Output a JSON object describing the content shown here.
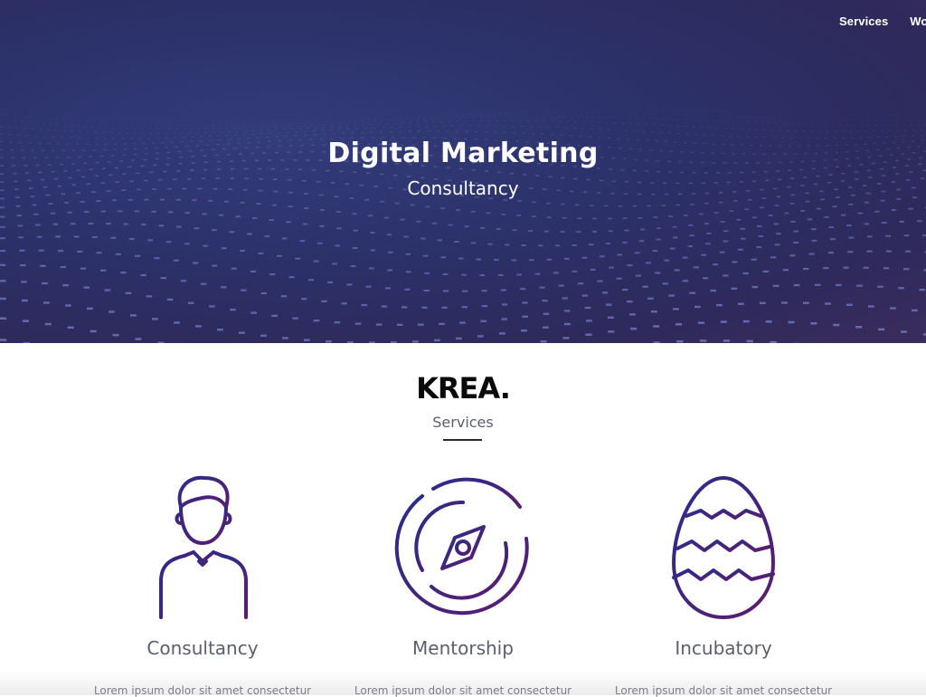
{
  "nav": {
    "items": [
      {
        "label": "Services"
      },
      {
        "label": "Work"
      }
    ]
  },
  "hero": {
    "title": "Digital Marketing",
    "subtitle": "Consultancy"
  },
  "brand": {
    "logo": "KREA."
  },
  "services_section": {
    "title": "Services",
    "items": [
      {
        "name": "Consultancy",
        "icon": "businessman-icon",
        "text": "Lorem ipsum dolor sit amet consectetur"
      },
      {
        "name": "Mentorship",
        "icon": "compass-icon",
        "text": "Lorem ipsum dolor sit amet consectetur"
      },
      {
        "name": "Incubatory",
        "icon": "egg-icon",
        "text": "Lorem ipsum dolor sit amet consectetur"
      }
    ]
  },
  "colors": {
    "hero_bg": "#2b3068",
    "icon_gradient_start": "#2a2d8a",
    "icon_gradient_end": "#5a1d6e",
    "text_muted": "#5a5f6e"
  }
}
